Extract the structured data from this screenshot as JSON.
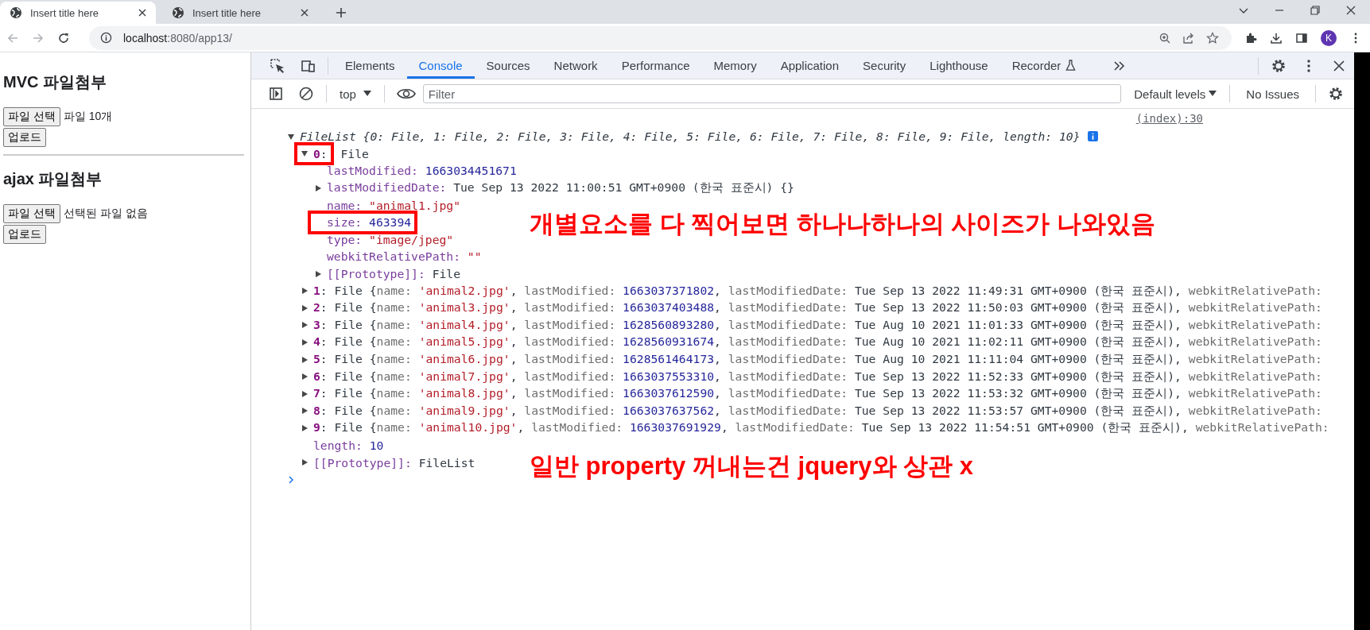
{
  "browser": {
    "tabs": [
      {
        "title": "Insert title here",
        "selected": true
      },
      {
        "title": "Insert title here",
        "selected": false
      }
    ],
    "address": {
      "host": "localhost",
      "path": ":8080/app13/"
    },
    "avatar": "K"
  },
  "page": {
    "sections": [
      {
        "heading": "MVC 파일첨부",
        "file_button": "파일 선택",
        "file_status": "파일 10개",
        "upload_button": "업로드"
      },
      {
        "heading": "ajax 파일첨부",
        "file_button": "파일 선택",
        "file_status": "선택된 파일 없음",
        "upload_button": "업로드"
      }
    ]
  },
  "devtools": {
    "tabs": [
      {
        "label": "Elements",
        "selected": false
      },
      {
        "label": "Console",
        "selected": true
      },
      {
        "label": "Sources",
        "selected": false
      },
      {
        "label": "Network",
        "selected": false
      },
      {
        "label": "Performance",
        "selected": false
      },
      {
        "label": "Memory",
        "selected": false
      },
      {
        "label": "Application",
        "selected": false
      },
      {
        "label": "Security",
        "selected": false
      },
      {
        "label": "Lighthouse",
        "selected": false
      },
      {
        "label": "Recorder",
        "selected": false
      }
    ],
    "context": "top",
    "filter": {
      "placeholder": "Filter"
    },
    "levels": "Default levels",
    "issues": "No Issues"
  },
  "console": {
    "source": "(index):30",
    "lines": [
      {
        "expanded": true,
        "info_badge": true,
        "tokens": [
          {
            "text": "FileList {0: File, 1: File, 2: File, 3: File, 4: File, 5: File, 6: File, 7: File, 8: File, 9: File, length: 10}",
            "kind": "italic"
          }
        ],
        "children": [
          {
            "expanded": true,
            "tokens": [
              {
                "text": "0",
                "kind": "index",
                "framed": true
              },
              {
                "text": ":",
                "kind": "plain",
                "framed": true
              },
              {
                "text": " File",
                "kind": "plain"
              }
            ],
            "children": [
              {
                "tokens": [
                  {
                    "text": "lastModified: ",
                    "kind": "key"
                  },
                  {
                    "text": "1663034451671",
                    "kind": "number"
                  }
                ]
              },
              {
                "expanded": false,
                "tokens": [
                  {
                    "text": "lastModifiedDate: ",
                    "kind": "key"
                  },
                  {
                    "text": "Tue Sep 13 2022 11:00:51 GMT+0900 (한국 표준시) {}",
                    "kind": "plain"
                  }
                ]
              },
              {
                "tokens": [
                  {
                    "text": "name: ",
                    "kind": "key"
                  },
                  {
                    "text": "\"animal1.jpg\"",
                    "kind": "string"
                  }
                ]
              },
              {
                "tokens": [
                  {
                    "text": "size: ",
                    "kind": "key",
                    "framed": true
                  },
                  {
                    "text": "463394",
                    "kind": "number",
                    "framed": true
                  }
                ]
              },
              {
                "tokens": [
                  {
                    "text": "type: ",
                    "kind": "key"
                  },
                  {
                    "text": "\"image/jpeg\"",
                    "kind": "string"
                  }
                ]
              },
              {
                "tokens": [
                  {
                    "text": "webkitRelativePath: ",
                    "kind": "key"
                  },
                  {
                    "text": "\"\"",
                    "kind": "string"
                  }
                ]
              },
              {
                "expanded": false,
                "tokens": [
                  {
                    "text": "[[Prototype]]: ",
                    "kind": "key"
                  },
                  {
                    "text": "File",
                    "kind": "plain"
                  }
                ]
              }
            ]
          },
          {
            "expanded": false,
            "tokens": [
              {
                "text": "1",
                "kind": "index"
              },
              {
                "text": ": File {",
                "kind": "plain"
              },
              {
                "text": "name: ",
                "kind": "pkey"
              },
              {
                "text": "'animal2.jpg'",
                "kind": "string"
              },
              {
                "text": ", ",
                "kind": "plain"
              },
              {
                "text": "lastModified: ",
                "kind": "pkey"
              },
              {
                "text": "1663037371802",
                "kind": "number"
              },
              {
                "text": ", ",
                "kind": "plain"
              },
              {
                "text": "lastModifiedDate: ",
                "kind": "pkey"
              },
              {
                "text": "Tue Sep 13 2022 11:49:31 GMT+0900 (한국 표준시), ",
                "kind": "plain"
              },
              {
                "text": "webkitRelativePath:",
                "kind": "pkey"
              }
            ]
          },
          {
            "expanded": false,
            "tokens": [
              {
                "text": "2",
                "kind": "index"
              },
              {
                "text": ": File {",
                "kind": "plain"
              },
              {
                "text": "name: ",
                "kind": "pkey"
              },
              {
                "text": "'animal3.jpg'",
                "kind": "string"
              },
              {
                "text": ", ",
                "kind": "plain"
              },
              {
                "text": "lastModified: ",
                "kind": "pkey"
              },
              {
                "text": "1663037403488",
                "kind": "number"
              },
              {
                "text": ", ",
                "kind": "plain"
              },
              {
                "text": "lastModifiedDate: ",
                "kind": "pkey"
              },
              {
                "text": "Tue Sep 13 2022 11:50:03 GMT+0900 (한국 표준시), ",
                "kind": "plain"
              },
              {
                "text": "webkitRelativePath:",
                "kind": "pkey"
              }
            ]
          },
          {
            "expanded": false,
            "tokens": [
              {
                "text": "3",
                "kind": "index"
              },
              {
                "text": ": File {",
                "kind": "plain"
              },
              {
                "text": "name: ",
                "kind": "pkey"
              },
              {
                "text": "'animal4.jpg'",
                "kind": "string"
              },
              {
                "text": ", ",
                "kind": "plain"
              },
              {
                "text": "lastModified: ",
                "kind": "pkey"
              },
              {
                "text": "1628560893280",
                "kind": "number"
              },
              {
                "text": ", ",
                "kind": "plain"
              },
              {
                "text": "lastModifiedDate: ",
                "kind": "pkey"
              },
              {
                "text": "Tue Aug 10 2021 11:01:33 GMT+0900 (한국 표준시), ",
                "kind": "plain"
              },
              {
                "text": "webkitRelativePath:",
                "kind": "pkey"
              }
            ]
          },
          {
            "expanded": false,
            "tokens": [
              {
                "text": "4",
                "kind": "index"
              },
              {
                "text": ": File {",
                "kind": "plain"
              },
              {
                "text": "name: ",
                "kind": "pkey"
              },
              {
                "text": "'animal5.jpg'",
                "kind": "string"
              },
              {
                "text": ", ",
                "kind": "plain"
              },
              {
                "text": "lastModified: ",
                "kind": "pkey"
              },
              {
                "text": "1628560931674",
                "kind": "number"
              },
              {
                "text": ", ",
                "kind": "plain"
              },
              {
                "text": "lastModifiedDate: ",
                "kind": "pkey"
              },
              {
                "text": "Tue Aug 10 2021 11:02:11 GMT+0900 (한국 표준시), ",
                "kind": "plain"
              },
              {
                "text": "webkitRelativePath:",
                "kind": "pkey"
              }
            ]
          },
          {
            "expanded": false,
            "tokens": [
              {
                "text": "5",
                "kind": "index"
              },
              {
                "text": ": File {",
                "kind": "plain"
              },
              {
                "text": "name: ",
                "kind": "pkey"
              },
              {
                "text": "'animal6.jpg'",
                "kind": "string"
              },
              {
                "text": ", ",
                "kind": "plain"
              },
              {
                "text": "lastModified: ",
                "kind": "pkey"
              },
              {
                "text": "1628561464173",
                "kind": "number"
              },
              {
                "text": ", ",
                "kind": "plain"
              },
              {
                "text": "lastModifiedDate: ",
                "kind": "pkey"
              },
              {
                "text": "Tue Aug 10 2021 11:11:04 GMT+0900 (한국 표준시), ",
                "kind": "plain"
              },
              {
                "text": "webkitRelativePath:",
                "kind": "pkey"
              }
            ]
          },
          {
            "expanded": false,
            "tokens": [
              {
                "text": "6",
                "kind": "index"
              },
              {
                "text": ": File {",
                "kind": "plain"
              },
              {
                "text": "name: ",
                "kind": "pkey"
              },
              {
                "text": "'animal7.jpg'",
                "kind": "string"
              },
              {
                "text": ", ",
                "kind": "plain"
              },
              {
                "text": "lastModified: ",
                "kind": "pkey"
              },
              {
                "text": "1663037553310",
                "kind": "number"
              },
              {
                "text": ", ",
                "kind": "plain"
              },
              {
                "text": "lastModifiedDate: ",
                "kind": "pkey"
              },
              {
                "text": "Tue Sep 13 2022 11:52:33 GMT+0900 (한국 표준시), ",
                "kind": "plain"
              },
              {
                "text": "webkitRelativePath:",
                "kind": "pkey"
              }
            ]
          },
          {
            "expanded": false,
            "tokens": [
              {
                "text": "7",
                "kind": "index"
              },
              {
                "text": ": File {",
                "kind": "plain"
              },
              {
                "text": "name: ",
                "kind": "pkey"
              },
              {
                "text": "'animal8.jpg'",
                "kind": "string"
              },
              {
                "text": ", ",
                "kind": "plain"
              },
              {
                "text": "lastModified: ",
                "kind": "pkey"
              },
              {
                "text": "1663037612590",
                "kind": "number"
              },
              {
                "text": ", ",
                "kind": "plain"
              },
              {
                "text": "lastModifiedDate: ",
                "kind": "pkey"
              },
              {
                "text": "Tue Sep 13 2022 11:53:32 GMT+0900 (한국 표준시), ",
                "kind": "plain"
              },
              {
                "text": "webkitRelativePath:",
                "kind": "pkey"
              }
            ]
          },
          {
            "expanded": false,
            "tokens": [
              {
                "text": "8",
                "kind": "index"
              },
              {
                "text": ": File {",
                "kind": "plain"
              },
              {
                "text": "name: ",
                "kind": "pkey"
              },
              {
                "text": "'animal9.jpg'",
                "kind": "string"
              },
              {
                "text": ", ",
                "kind": "plain"
              },
              {
                "text": "lastModified: ",
                "kind": "pkey"
              },
              {
                "text": "1663037637562",
                "kind": "number"
              },
              {
                "text": ", ",
                "kind": "plain"
              },
              {
                "text": "lastModifiedDate: ",
                "kind": "pkey"
              },
              {
                "text": "Tue Sep 13 2022 11:53:57 GMT+0900 (한국 표준시), ",
                "kind": "plain"
              },
              {
                "text": "webkitRelativePath:",
                "kind": "pkey"
              }
            ]
          },
          {
            "expanded": false,
            "tokens": [
              {
                "text": "9",
                "kind": "index"
              },
              {
                "text": ": File {",
                "kind": "plain"
              },
              {
                "text": "name: ",
                "kind": "pkey"
              },
              {
                "text": "'animal10.jpg'",
                "kind": "string"
              },
              {
                "text": ", ",
                "kind": "plain"
              },
              {
                "text": "lastModified: ",
                "kind": "pkey"
              },
              {
                "text": "1663037691929",
                "kind": "number"
              },
              {
                "text": ", ",
                "kind": "plain"
              },
              {
                "text": "lastModifiedDate: ",
                "kind": "pkey"
              },
              {
                "text": "Tue Sep 13 2022 11:54:51 GMT+0900 (한국 표준시), ",
                "kind": "plain"
              },
              {
                "text": "webkitRelativePath:",
                "kind": "pkey"
              }
            ]
          },
          {
            "tokens": [
              {
                "text": "length: ",
                "kind": "key"
              },
              {
                "text": "10",
                "kind": "number"
              }
            ]
          },
          {
            "expanded": false,
            "tokens": [
              {
                "text": "[[Prototype]]: ",
                "kind": "key"
              },
              {
                "text": "FileList",
                "kind": "plain"
              }
            ]
          }
        ]
      }
    ]
  },
  "annotations": [
    "개별요소를 다 찍어보면 하나나하나의 사이즈가 나와있음",
    "일반 property 꺼내는건 jquery와 상관 x"
  ]
}
